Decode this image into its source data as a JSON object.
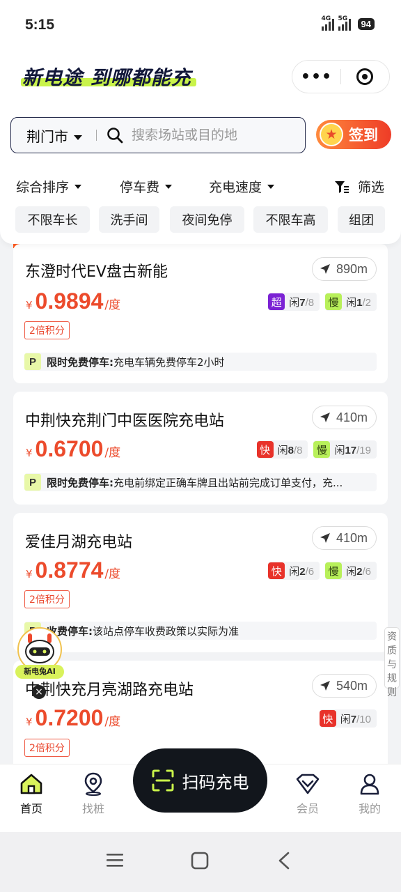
{
  "status": {
    "time": "5:15",
    "net1": "4G",
    "net2": "5G",
    "battery": "94"
  },
  "header": {
    "slogan": "新电途 到哪都能充",
    "menu_icon": "more-dots-icon",
    "target_icon": "target-icon"
  },
  "search": {
    "city": "荆门市",
    "placeholder": "搜索场站或目的地",
    "checkin_label": "签到"
  },
  "filters": {
    "sort": [
      {
        "label": "综合排序"
      },
      {
        "label": "停车费"
      },
      {
        "label": "充电速度"
      }
    ],
    "filter_label": "筛选",
    "tags": [
      "不限车长",
      "洗手间",
      "夜间免停",
      "不限车高",
      "组团"
    ]
  },
  "stations": [
    {
      "name": "东澄时代EV盘古新能",
      "distance": "890m",
      "currency": "¥",
      "price": "0.9894",
      "unit": "/度",
      "chargers": [
        {
          "type": "超",
          "idle_label": "闲",
          "idle": "7",
          "total": "/8",
          "color": "#7b22d4"
        },
        {
          "type": "慢",
          "idle_label": "闲",
          "idle": "1",
          "total": "/2",
          "color": "#b8f05a"
        }
      ],
      "points": "2倍积分",
      "parking": {
        "icon": "P",
        "title": "限时免费停车:",
        "desc": "充电车辆免费停车2小时"
      }
    },
    {
      "name": "中荆快充荆门中医医院充电站",
      "distance": "410m",
      "currency": "¥",
      "price": "0.6700",
      "unit": "/度",
      "chargers": [
        {
          "type": "快",
          "idle_label": "闲",
          "idle": "8",
          "total": "/8",
          "color": "#e8322a"
        },
        {
          "type": "慢",
          "idle_label": "闲",
          "idle": "17",
          "total": "/19",
          "color": "#b8f05a"
        }
      ],
      "parking": {
        "icon": "P",
        "title": "限时免费停车:",
        "desc": "充电前绑定正确车牌且出站前完成订单支付，充..."
      }
    },
    {
      "name": "爱佳月湖充电站",
      "distance": "410m",
      "currency": "¥",
      "price": "0.8774",
      "unit": "/度",
      "chargers": [
        {
          "type": "快",
          "idle_label": "闲",
          "idle": "2",
          "total": "/6",
          "color": "#e8322a"
        },
        {
          "type": "慢",
          "idle_label": "闲",
          "idle": "2",
          "total": "/6",
          "color": "#b8f05a"
        }
      ],
      "points": "2倍积分",
      "parking": {
        "icon": "P",
        "title": "收费停车:",
        "desc": "该站点停车收费政策以实际为准"
      }
    },
    {
      "name": "中荆快充月亮湖路充电站",
      "distance": "540m",
      "currency": "¥",
      "price": "0.7200",
      "unit": "/度",
      "chargers": [
        {
          "type": "快",
          "idle_label": "闲",
          "idle": "7",
          "total": "/10",
          "color": "#e8322a"
        }
      ],
      "points": "2倍积分"
    }
  ],
  "ai_bot": {
    "label": "新电兔AI",
    "close": "×"
  },
  "side_tab": {
    "label": "资质与规则"
  },
  "tabbar": {
    "tabs": [
      {
        "label": "首页",
        "icon": "home-icon"
      },
      {
        "label": "找桩",
        "icon": "location-pin-icon"
      },
      {
        "label": "会员",
        "icon": "vip-diamond-icon"
      },
      {
        "label": "我的",
        "icon": "user-icon"
      }
    ],
    "scan_label": "扫码充电"
  }
}
